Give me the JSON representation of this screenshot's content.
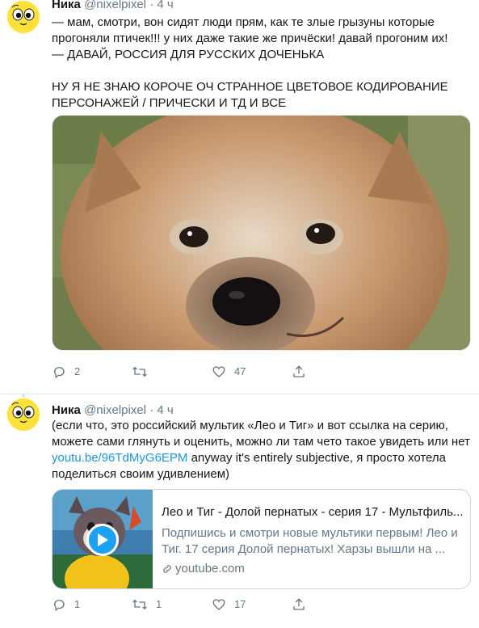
{
  "tweets": [
    {
      "author": {
        "name": "Ника",
        "handle": "@nixelpixel",
        "separator": "·",
        "time": "4 ч",
        "avatar_icon": "yellow-emoji-face"
      },
      "text_lines": [
        "— мам, смотри, вон сидят люди прям, как те злые грызуны которые",
        "прогоняли птичек!!! у них даже такие же причёски! давай прогоним их!",
        "— ДАВАЙ, РОССИЯ ДЛЯ РУССКИХ ДОЧЕНЬКА",
        "НУ Я НЕ ЗНАЮ КОРОЧЕ ОЧ СТРАННОЕ ЦВЕТОВОЕ КОДИРОВАНИЕ",
        "ПЕРСОНАЖЕЙ / ПРИЧЕСКИ И ТД И ВСЕ"
      ],
      "media": {
        "type": "photo",
        "subject": "close-up of a fluffy puppy face"
      },
      "actions": {
        "replies": "2",
        "retweets": "",
        "likes": "47"
      }
    },
    {
      "author": {
        "name": "Ника",
        "handle": "@nixelpixel",
        "separator": "·",
        "time": "4 ч",
        "avatar_icon": "yellow-emoji-face"
      },
      "text_lines": [
        "(если что, это российский мультик «Лео и Тиг» и вот ссылка на серию,",
        "можете сами глянуть и оценить, можно ли там чето такое увидеть или нет"
      ],
      "link": "youtu.be/96TdMyG6EPM",
      "link_tail": " anyway it's entirely subjective, я просто хотела",
      "text_last": "поделиться своим удивлением)",
      "card": {
        "title": "Лео и Тиг - Долой пернатых - серия 17 - Мультфиль...",
        "description": "Подпишись и смотри новые мультики первым! Лео и Тиг. 17 серия Долой пернатых! Харзы вышли на ...",
        "domain": "youtube.com",
        "thumb_icon": "cartoon-character-thumbnail",
        "play_icon": "play-icon"
      },
      "actions": {
        "replies": "1",
        "retweets": "1",
        "likes": "17"
      }
    }
  ],
  "colors": {
    "text": "#14171a",
    "secondary": "#657786",
    "link": "#1b95e0",
    "border": "#ccd6dd",
    "play": "#1da1f2",
    "avatar": "#ffe13a"
  }
}
